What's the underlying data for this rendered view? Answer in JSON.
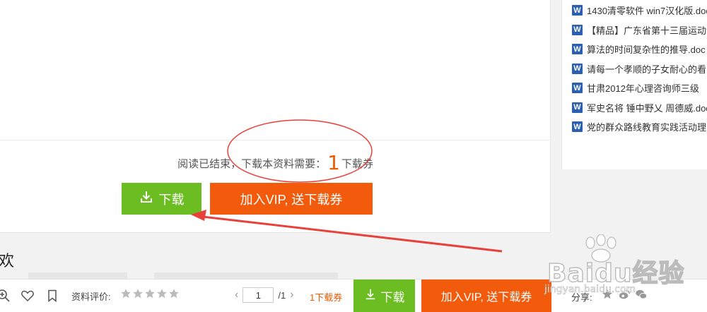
{
  "document_end": {
    "message": "阅读已结束，下载本资料需要：",
    "count": "1",
    "unit": "下载券"
  },
  "buttons": {
    "download": "下载",
    "vip": "加入VIP, 送下载券"
  },
  "sidebar": {
    "items": [
      {
        "label": "1430清零软件 win7汉化版.doc"
      },
      {
        "label": "【精品】广东省第十三届运动会"
      },
      {
        "label": "算法的时间复杂性的推导.doc"
      },
      {
        "label": "请每一个孝顺的子女耐心的看"
      },
      {
        "label": "甘肃2012年心理咨询师三级"
      },
      {
        "label": "军史名将 锤中野乂 周德威.doc"
      },
      {
        "label": "党的群众路线教育实践活动理"
      }
    ],
    "item_icon": "word-doc-icon",
    "icon_letter": "W"
  },
  "section": {
    "heading": "欢"
  },
  "toolbar": {
    "rating_label": "资料评价:",
    "page_value": "1",
    "page_total": "/1",
    "coupon_text": "1下载券",
    "download": "下载",
    "vip": "加入VIP, 送下载券",
    "share_label": "分享:"
  },
  "watermark": {
    "brand": "Baidu经验",
    "url": "jingyan.baidu.com"
  },
  "colors": {
    "green": "#6cbd22",
    "orange": "#f25a0c",
    "accent_text": "#f05a00",
    "word_blue": "#2b5fb4",
    "annotation_red": "#e8413b"
  }
}
